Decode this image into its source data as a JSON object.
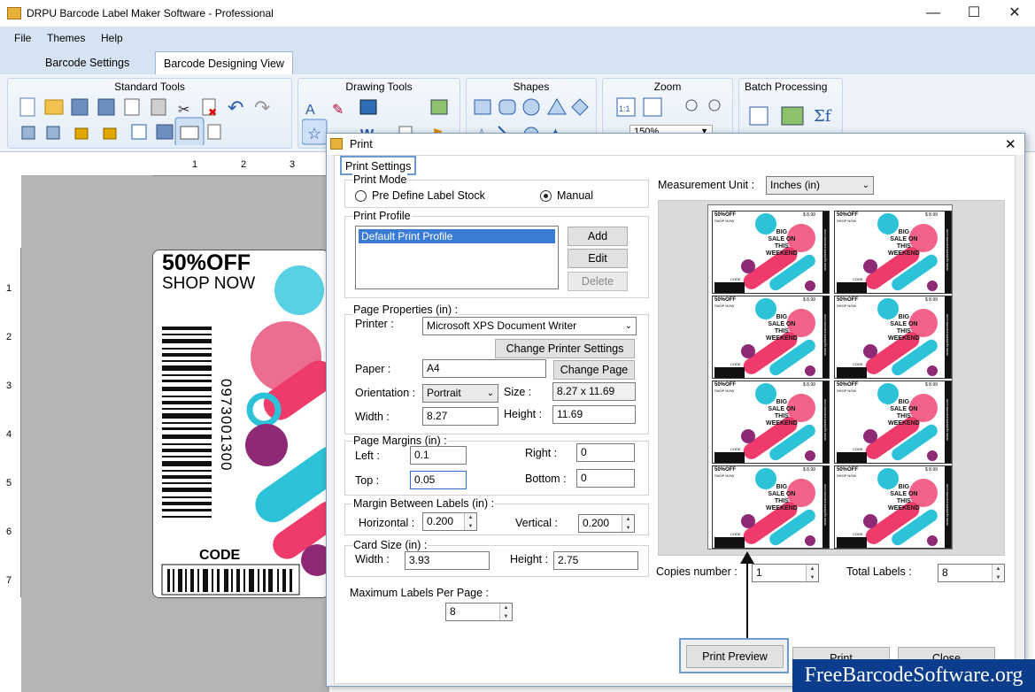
{
  "app": {
    "title": "DRPU Barcode Label Maker Software - Professional"
  },
  "menu": [
    "File",
    "Themes",
    "Help"
  ],
  "tabs": [
    "Barcode Settings",
    "Barcode Designing View"
  ],
  "ribbon": {
    "groups": [
      "Standard Tools",
      "Drawing Tools",
      "Shapes",
      "Zoom",
      "Batch Processing"
    ],
    "zoom_value": "150%"
  },
  "ruler": {
    "h_ticks": [
      "1",
      "2",
      "3"
    ],
    "v_ticks": [
      "1",
      "2",
      "3",
      "4",
      "5",
      "6",
      "7"
    ]
  },
  "label": {
    "headline": "50%OFF",
    "subline": "SHOP NOW",
    "number": "0973001300",
    "code": "CODE"
  },
  "dialog": {
    "title": "Print",
    "tab": "Print Settings",
    "print_mode": {
      "legend": "Print Mode",
      "option1": "Pre Define Label Stock",
      "option2": "Manual",
      "selected": "Manual"
    },
    "print_profile": {
      "legend": "Print Profile",
      "items": [
        "Default Print Profile"
      ],
      "add": "Add",
      "edit": "Edit",
      "delete": "Delete"
    },
    "page_properties": {
      "legend": "Page Properties (in) :",
      "printer_label": "Printer :",
      "printer_value": "Microsoft XPS Document Writer",
      "change_printer": "Change Printer Settings",
      "paper_label": "Paper :",
      "paper_value": "A4",
      "change_page": "Change Page",
      "orientation_label": "Orientation :",
      "orientation_value": "Portrait",
      "size_label": "Size :",
      "size_value": "8.27 x 11.69",
      "width_label": "Width :",
      "width_value": "8.27",
      "height_label": "Height :",
      "height_value": "11.69"
    },
    "page_margins": {
      "legend": "Page Margins (in) :",
      "left_label": "Left :",
      "left_value": "0.1",
      "right_label": "Right :",
      "right_value": "0",
      "top_label": "Top :",
      "top_value": "0.05",
      "bottom_label": "Bottom :",
      "bottom_value": "0"
    },
    "margin_between": {
      "legend": "Margin Between Labels (in) :",
      "horizontal_label": "Horizontal :",
      "horizontal_value": "0.200",
      "vertical_label": "Vertical :",
      "vertical_value": "0.200"
    },
    "card_size": {
      "legend": "Card Size (in) :",
      "width_label": "Width :",
      "width_value": "3.93",
      "height_label": "Height :",
      "height_value": "2.75"
    },
    "max_labels": {
      "label": "Maximum Labels Per Page :",
      "value": "8"
    },
    "measurement": {
      "label": "Measurement Unit :",
      "value": "Inches (in)"
    },
    "copies": {
      "label": "Copies number :",
      "value": "1"
    },
    "total": {
      "label": "Total Labels :",
      "value": "8"
    },
    "buttons": {
      "preview": "Print Preview",
      "print": "Print",
      "close": "Close"
    },
    "mini_label": {
      "headline": "50%OFF",
      "subline": "SHOP NOW",
      "big": "BIG",
      "sale": "SALE ON",
      "this": "THIS",
      "weekend": "WEEKEND",
      "price": "$ 8.99",
      "url": "www.xyzfashionworld.com",
      "code": "CODE"
    }
  },
  "watermark": "FreeBarcodeSoftware.org",
  "colors": {
    "ribbon_bg": "#d5e3f3",
    "dialog_border": "#7a9ec7",
    "accent_pink": "#ef3b6c",
    "accent_cyan": "#2cc3d8",
    "accent_purple": "#8e2a75",
    "watermark_bg": "#0b3d8c"
  }
}
